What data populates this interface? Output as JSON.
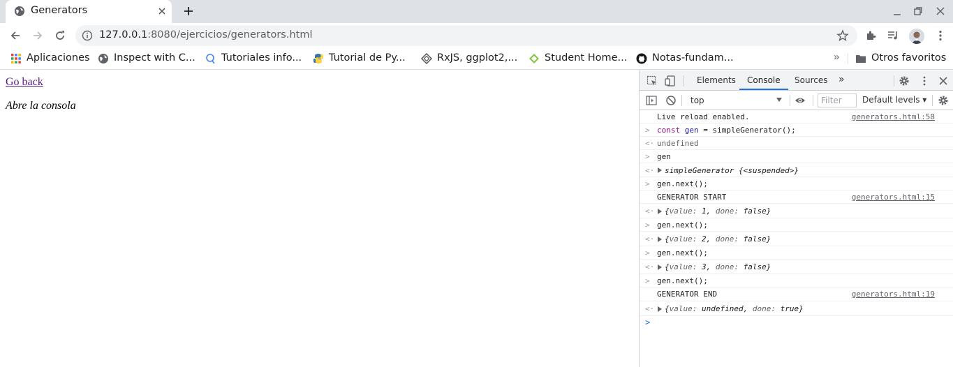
{
  "browser": {
    "tab_title": "Generators",
    "url_host": "127.0.0.1",
    "url_rest": ":8080/ejercicios/generators.html"
  },
  "bookmarks": [
    {
      "label": "Aplicaciones",
      "icon": "apps-grid-icon"
    },
    {
      "label": "Inspect with C...",
      "icon": "globe-icon"
    },
    {
      "label": "Tutoriales info...",
      "icon": "search-bubble-icon"
    },
    {
      "label": "Tutorial de Py...",
      "icon": "python-icon"
    },
    {
      "label": "RxJS, ggplot2,...",
      "icon": "diamond-icon"
    },
    {
      "label": "Student Home...",
      "icon": "leaf-icon"
    },
    {
      "label": "Notas-fundam...",
      "icon": "github-icon"
    }
  ],
  "bookmarks_more": "»",
  "other_favorites": "Otros favoritos",
  "page": {
    "link": "Go back",
    "text": "Abre la consola"
  },
  "devtools": {
    "tabs": [
      "Elements",
      "Console",
      "Sources"
    ],
    "active_tab": "Console",
    "more_tabs": "»",
    "context": "top",
    "filter_placeholder": "Filter",
    "levels": "Default levels"
  },
  "console": {
    "live_reload": "Live reload enabled.",
    "src_58": "generators.html:58",
    "cmd1_kw": "const",
    "cmd1_var": "gen",
    "cmd1_rest": " = simpleGenerator();",
    "undefined": "undefined",
    "cmd2": "gen",
    "gen_obj": "simpleGenerator {<suspended>}",
    "cmd_next": "gen.next();",
    "gen_start": "GENERATOR START",
    "src_15": "generators.html:15",
    "res1": "{value: 1, done: false}",
    "res2": "{value: 2, done: false}",
    "res3": "{value: 3, done: false}",
    "gen_end": "GENERATOR END",
    "src_19": "generators.html:19",
    "res4": "{value: undefined, done: true}"
  },
  "colors": {
    "accent": "#1a73e8",
    "tabstrip": "#dee1e6",
    "link": "#551a8b"
  }
}
